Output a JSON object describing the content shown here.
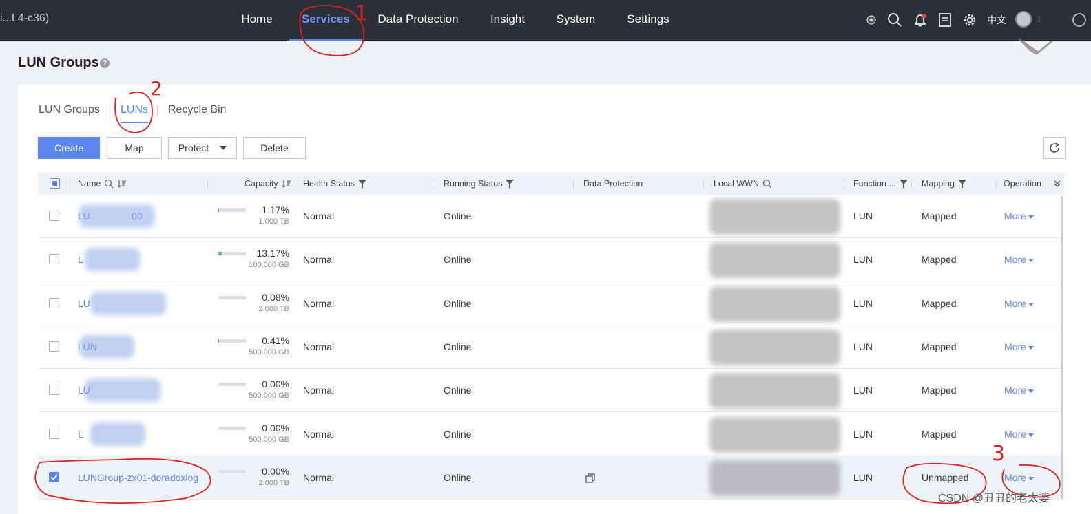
{
  "topbar": {
    "device_name": "i...L4-c36)",
    "nav": [
      "Home",
      "Services",
      "Data Protection",
      "Insight",
      "System",
      "Settings"
    ],
    "active_nav": "Services",
    "language": "中文",
    "user_name": "1"
  },
  "page": {
    "title": "LUN Groups",
    "tabs": [
      "LUN Groups",
      "LUNs",
      "Recycle Bin"
    ],
    "active_tab": "LUNs"
  },
  "toolbar": {
    "create": "Create",
    "map": "Map",
    "protect": "Protect",
    "delete": "Delete"
  },
  "table": {
    "columns": {
      "name": "Name",
      "capacity": "Capacity",
      "health": "Health Status",
      "running": "Running Status",
      "protection": "Data Protection",
      "wwn": "Local WWN",
      "function": "Function ...",
      "mapping": "Mapping",
      "operation": "Operation"
    },
    "rows": [
      {
        "name": "LU",
        "name_tail": "00",
        "pct": "1.17%",
        "fill": 0.0117,
        "total": "1.000 TB",
        "health": "Normal",
        "running": "Online",
        "function": "LUN",
        "mapping": "Mapped",
        "more": "More",
        "selected": false
      },
      {
        "name": "L",
        "name_tail": "",
        "pct": "13.17%",
        "fill": 0.1317,
        "total": "100.000 GB",
        "health": "Normal",
        "running": "Online",
        "function": "LUN",
        "mapping": "Mapped",
        "more": "More",
        "selected": false
      },
      {
        "name": "LU",
        "name_tail": "",
        "pct": "0.08%",
        "fill": 0.0008,
        "total": "2.000 TB",
        "health": "Normal",
        "running": "Online",
        "function": "LUN",
        "mapping": "Mapped",
        "more": "More",
        "selected": false
      },
      {
        "name": "LUN",
        "name_tail": "",
        "pct": "0.41%",
        "fill": 0.0041,
        "total": "500.000 GB",
        "health": "Normal",
        "running": "Online",
        "function": "LUN",
        "mapping": "Mapped",
        "more": "More",
        "selected": false
      },
      {
        "name": "LU",
        "name_tail": "",
        "pct": "0.00%",
        "fill": 0,
        "total": "500.000 GB",
        "health": "Normal",
        "running": "Online",
        "function": "LUN",
        "mapping": "Mapped",
        "more": "More",
        "selected": false
      },
      {
        "name": "L",
        "name_tail": "",
        "pct": "0.00%",
        "fill": 0,
        "total": "500.000 GB",
        "health": "Normal",
        "running": "Online",
        "function": "LUN",
        "mapping": "Mapped",
        "more": "More",
        "selected": false
      },
      {
        "name": "LUNGroup-zx01-doradoxlog",
        "name_tail": "",
        "pct": "0.00%",
        "fill": 0,
        "total": "2.000 TB",
        "health": "Normal",
        "running": "Online",
        "function": "LUN",
        "mapping": "Unmapped",
        "more": "More",
        "selected": true
      }
    ]
  },
  "annotations": {
    "n1": "1",
    "n2": "2",
    "n3": "3",
    "color": "#e0201c"
  },
  "watermark": "CSDN @丑丑的老太婆",
  "colors": {
    "accent": "#5b85ef",
    "topbar": "#2a2f3a"
  }
}
